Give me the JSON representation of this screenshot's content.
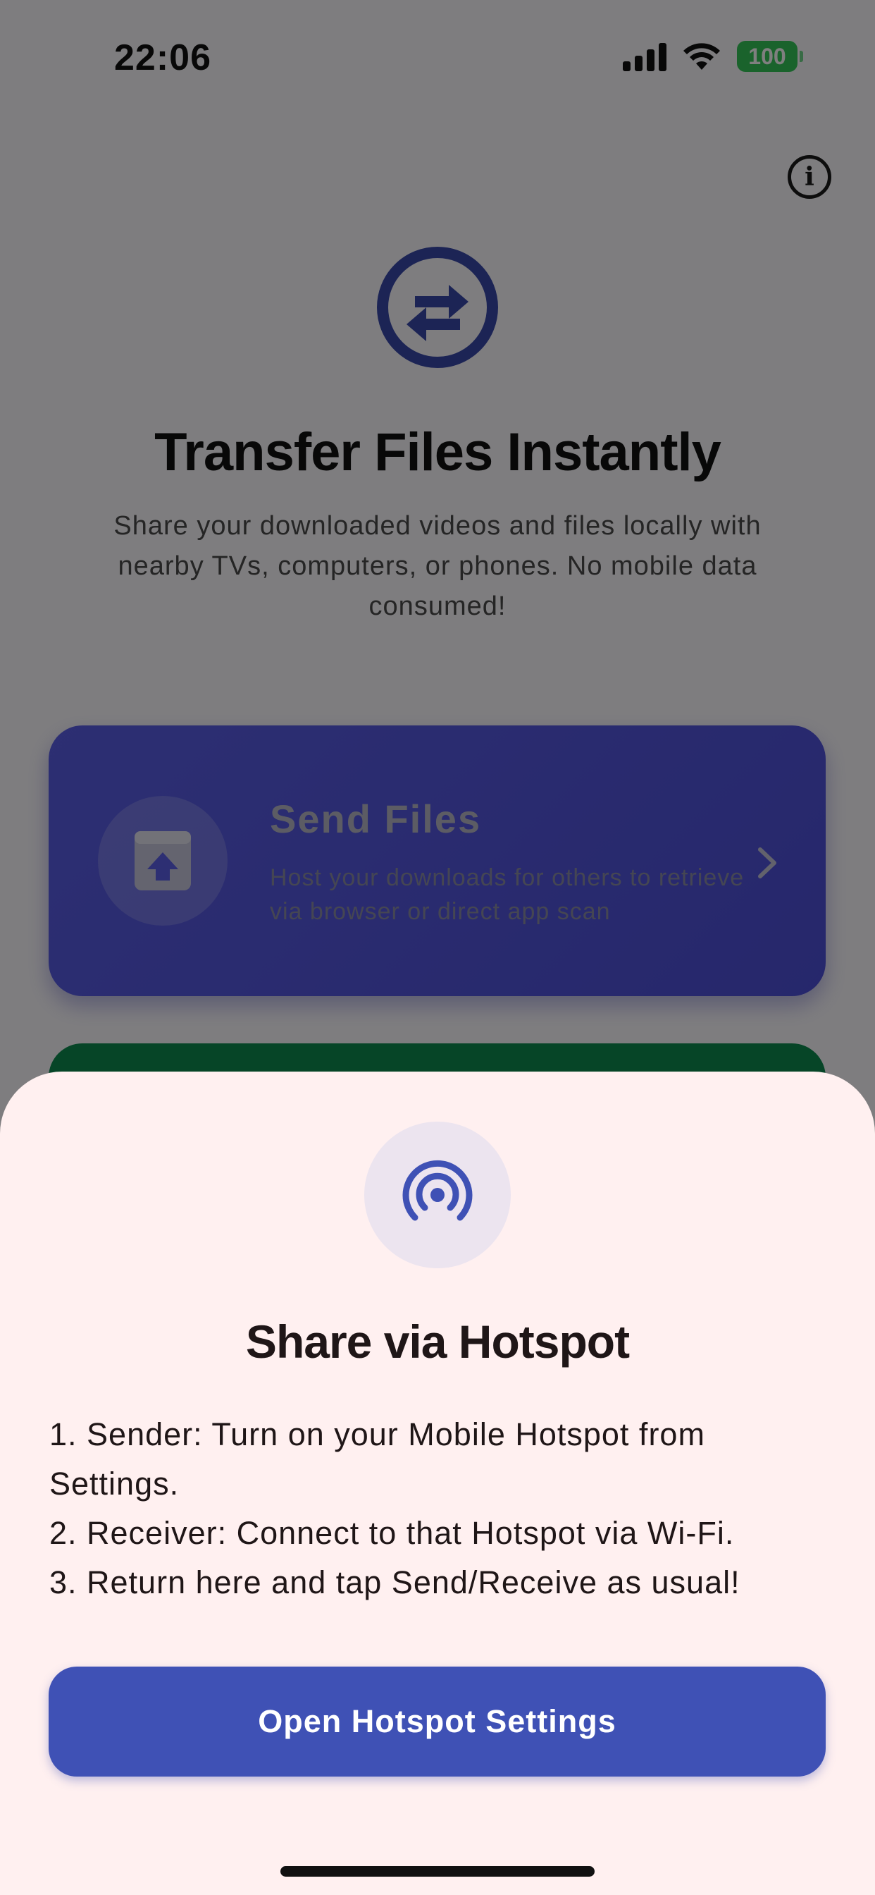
{
  "status_bar": {
    "time": "22:06",
    "battery": "100",
    "battery_color": "#34c759"
  },
  "header": {
    "info_icon": "info-icon"
  },
  "hero": {
    "icon": "swap-arrows-icon",
    "title": "Transfer Files Instantly",
    "subtitle": "Share your downloaded videos and files locally with nearby TVs, computers, or phones. No mobile data consumed!"
  },
  "send_card": {
    "icon": "upload-box-icon",
    "title": "Send Files",
    "description": "Host your downloads for others to retrieve via browser or direct app scan",
    "chevron": "chevron-right-icon",
    "color": "#5a5ee6"
  },
  "receive_card": {
    "color": "#0c8a4e"
  },
  "sheet": {
    "icon": "hotspot-icon",
    "title": "Share via Hotspot",
    "steps": [
      "1. Sender: Turn on your Mobile Hotspot from Settings.",
      "2. Receiver: Connect to that Hotspot via Wi-Fi.",
      "3. Return here and tap Send/Receive as usual!"
    ],
    "button_label": "Open Hotspot Settings",
    "accent": "#3f51b5",
    "background": "#fff0f0"
  }
}
